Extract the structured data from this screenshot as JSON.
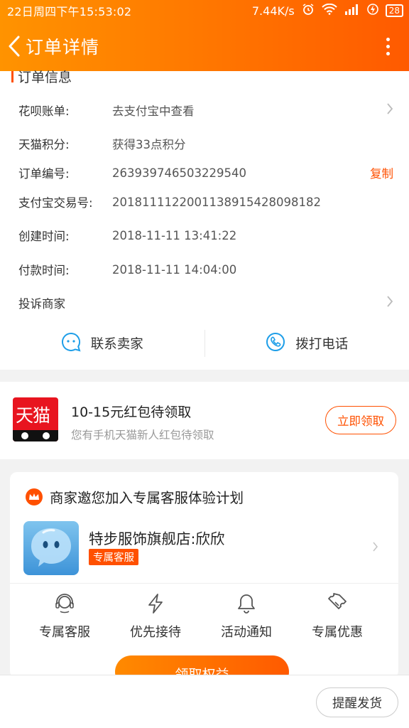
{
  "status_bar": {
    "datetime": "22日周四下午15:53:02",
    "network_speed": "7.44K/s",
    "battery": "28",
    "icons": [
      "alarm-icon",
      "wifi-icon",
      "signal-icon",
      "charging-icon",
      "battery-icon"
    ]
  },
  "header": {
    "title": "订单详情"
  },
  "order_info": {
    "section_title": "订单信息",
    "rows": [
      {
        "label": "花呗账单:",
        "value": "去支付宝中查看",
        "has_arrow": true
      },
      {
        "label": "天猫积分:",
        "value": "获得33点积分"
      },
      {
        "label": "订单编号:",
        "value": "263939746503229540",
        "action": "复制"
      },
      {
        "label": "支付宝交易号:",
        "value": "2018111122001138915428098182"
      },
      {
        "label": "创建时间:",
        "value": "2018-11-11 13:41:22"
      },
      {
        "label": "付款时间:",
        "value": "2018-11-11 14:04:00"
      },
      {
        "label": "投诉商家",
        "value": "",
        "has_arrow": true
      }
    ],
    "contact_seller": "联系卖家",
    "call_phone": "拨打电话"
  },
  "coupon": {
    "logo_text": "天猫",
    "title": "10-15元红包待领取",
    "subtitle": "您有手机天猫新人红包待领取",
    "button": "立即领取"
  },
  "service": {
    "header": "商家邀您加入专属客服体验计划",
    "store_name": "特步服饰旗舰店:欣欣",
    "badge": "专属客服",
    "benefits": [
      {
        "label": "专属客服",
        "icon": "headset-icon"
      },
      {
        "label": "优先接待",
        "icon": "lightning-icon"
      },
      {
        "label": "活动通知",
        "icon": "bell-icon"
      },
      {
        "label": "专属优惠",
        "icon": "ticket-icon"
      }
    ],
    "button": "领取权益"
  },
  "bottom": {
    "remind_button": "提醒发货"
  },
  "colors": {
    "accent": "#ff5000",
    "header_start": "#ff9300",
    "header_end": "#ff5a00",
    "contact_icon": "#1e9ee8"
  }
}
